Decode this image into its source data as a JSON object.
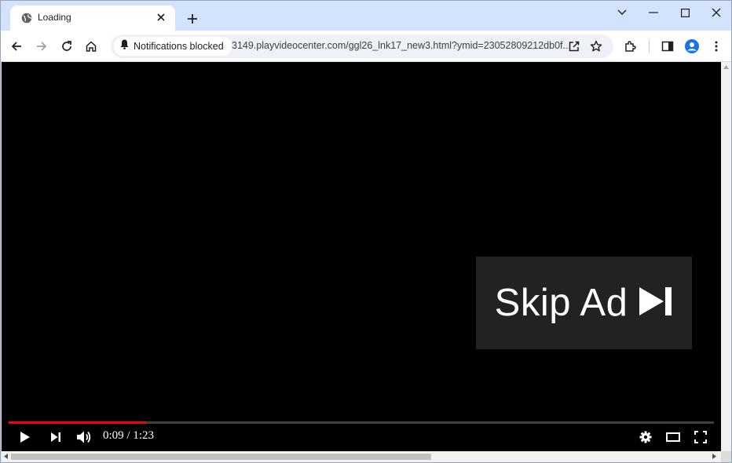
{
  "browser": {
    "tab": {
      "title": "Loading"
    },
    "toolbar": {
      "permission_chip": "Notifications blocked",
      "url": "3149.playvideocenter.com/ggl26_lnk17_new3.html?ymid=23052809212db0f..."
    }
  },
  "player": {
    "skip_label": "Skip Ad",
    "time_display": "0:09 / 1:23",
    "progress_fraction": 0.195
  },
  "colors": {
    "progress": "#ff0000",
    "tabstrip": "#d3e3fd",
    "avatar": "#1a73e8"
  },
  "icons": [
    "globe-icon",
    "close-icon",
    "plus-icon",
    "chevron-down-icon",
    "minimize-icon",
    "maximize-icon",
    "window-close-icon",
    "back-icon",
    "forward-icon",
    "reload-icon",
    "home-icon",
    "bell-icon",
    "share-icon",
    "star-icon",
    "extensions-icon",
    "sidepanel-icon",
    "profile-icon",
    "menu-icon",
    "play-icon",
    "next-icon",
    "volume-icon",
    "settings-icon",
    "theater-icon",
    "fullscreen-icon"
  ]
}
